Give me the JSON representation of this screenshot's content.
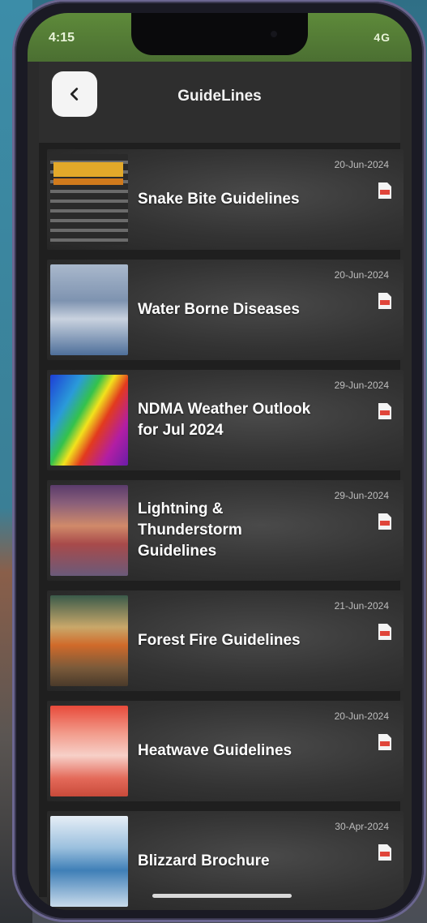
{
  "status_bar": {
    "time": "4:15",
    "right_indicators": "4G"
  },
  "header": {
    "title": "GuideLines",
    "back_icon": "chevron-left-icon"
  },
  "guidelines": [
    {
      "title": "Snake Bite Guidelines",
      "date": "20-Jun-2024",
      "file_icon": "pdf-icon"
    },
    {
      "title": "Water Borne Diseases",
      "date": "20-Jun-2024",
      "file_icon": "pdf-icon"
    },
    {
      "title": "NDMA Weather Outlook for Jul 2024",
      "date": "29-Jun-2024",
      "file_icon": "pdf-icon"
    },
    {
      "title": "Lightning & Thunderstorm Guidelines",
      "date": "29-Jun-2024",
      "file_icon": "pdf-icon"
    },
    {
      "title": "Forest Fire Guidelines",
      "date": "21-Jun-2024",
      "file_icon": "pdf-icon"
    },
    {
      "title": "Heatwave Guidelines",
      "date": "20-Jun-2024",
      "file_icon": "pdf-icon"
    },
    {
      "title": "Blizzard Brochure",
      "date": "30-Apr-2024",
      "file_icon": "pdf-icon"
    }
  ],
  "colors": {
    "status_bar_green": "#4b6f32",
    "pdf_red": "#e0453a",
    "row_background": "#333333"
  }
}
